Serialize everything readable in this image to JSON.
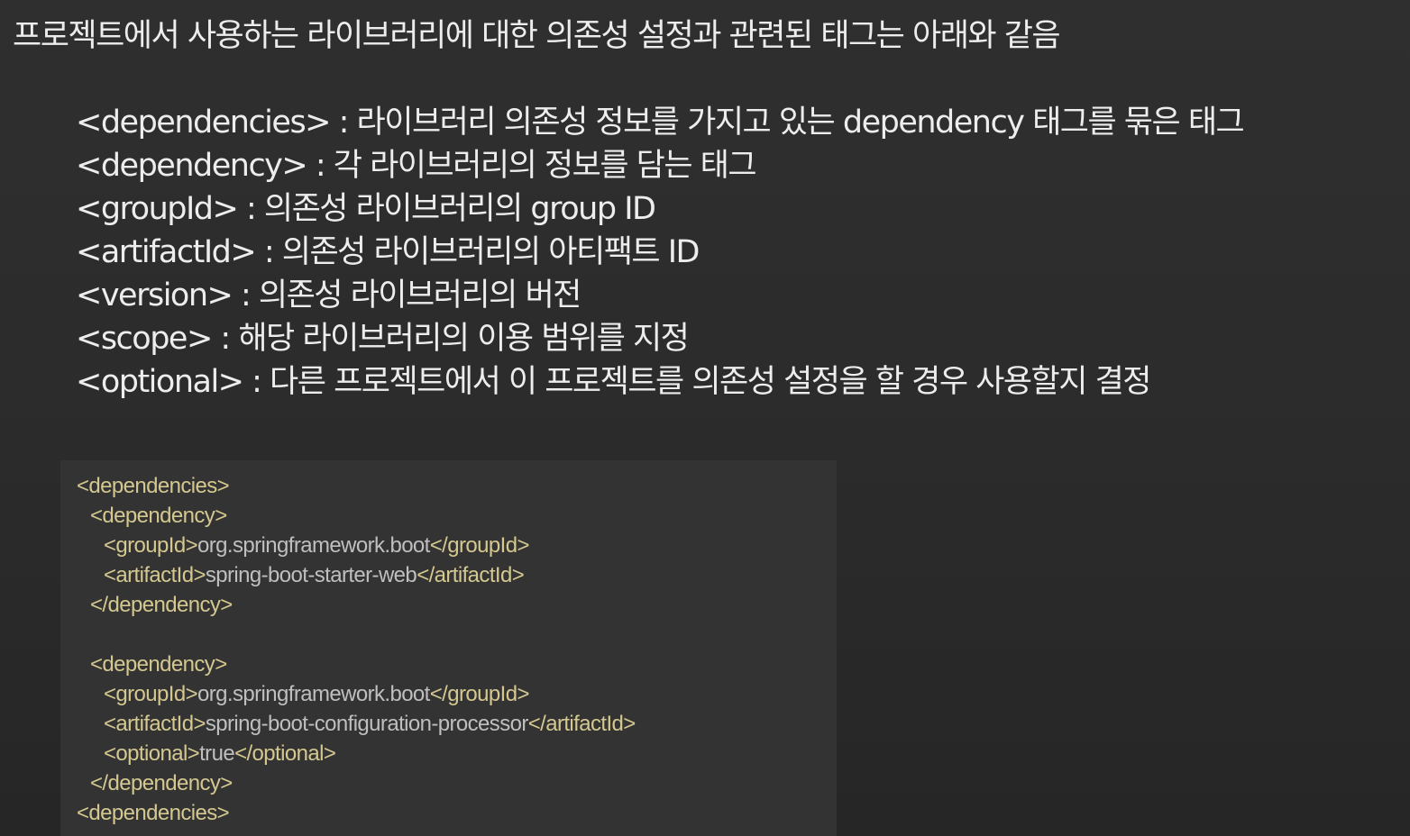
{
  "title": "프로젝트에서 사용하는 라이브러리에 대한 의존성 설정과 관련된 태그는 아래와 같음",
  "tags": [
    {
      "text": "<dependencies> : 라이브러리 의존성 정보를 가지고 있는 dependency 태그를 묶은 태그"
    },
    {
      "text": "<dependency> : 각 라이브러리의 정보를 담는 태그"
    },
    {
      "text": "<groupId> : 의존성 라이브러리의 group ID"
    },
    {
      "text": "<artifactId> : 의존성 라이브러리의 아티팩트 ID"
    },
    {
      "text": "<version> : 의존성 라이브러리의 버전"
    },
    {
      "text": "<scope> : 해당 라이브러리의 이용 범위를 지정"
    },
    {
      "text": "<optional> : 다른 프로젝트에서 이 프로젝트를 의존성 설정을 할 경우 사용할지 결정"
    }
  ],
  "code": {
    "l1": {
      "open": "<dependencies>"
    },
    "l2": {
      "open": "<dependency>"
    },
    "l3": {
      "open": "<groupId>",
      "value": "org.springframework.boot",
      "close": "</groupId>"
    },
    "l4": {
      "open": "<artifactId>",
      "value": "spring-boot-starter-web",
      "close": "</artifactId>"
    },
    "l5": {
      "open": "</dependency>"
    },
    "l6": {
      "open": "<dependency>"
    },
    "l7": {
      "open": "<groupId>",
      "value": "org.springframework.boot",
      "close": "</groupId>"
    },
    "l8": {
      "open": "<artifactId>",
      "value": "spring-boot-configuration-processor",
      "close": "</artifactId>"
    },
    "l9": {
      "open": "<optional>",
      "value": "true",
      "close": "</optional>"
    },
    "l10": {
      "open": "</dependency>"
    },
    "l11": {
      "open": "<dependencies>"
    }
  }
}
